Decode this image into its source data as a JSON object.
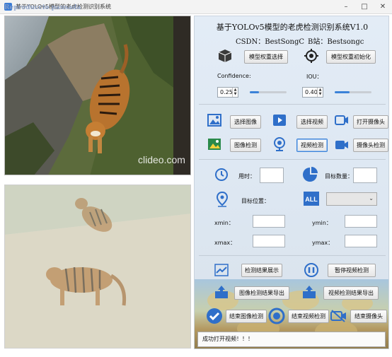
{
  "window": {
    "title": "基于YOLOv5模型的老虎检测识别系统",
    "watermark": "Reproduccio pausada",
    "min_icon": "minimize-icon",
    "max_icon": "maximize-icon",
    "close_icon": "close-icon"
  },
  "images": {
    "top_watermark": "clideo.com"
  },
  "header": {
    "title": "基于YOLOv5模型的老虎检测识别系统V1.0",
    "csdn": "CSDN：BestSongC",
    "bilibili": "B站：Bestsongc"
  },
  "model": {
    "select_label": "模型权重选择",
    "init_label": "模型权重初始化"
  },
  "params": {
    "confidence_label": "Confidence:",
    "confidence_value": "0.25",
    "confidence_level": 0.25,
    "iou_label": "IOU：",
    "iou_value": "0.40",
    "iou_level": 0.4
  },
  "actions": {
    "select_image": "选择图像",
    "select_video": "选择视频",
    "open_camera": "打开摄像头",
    "image_detect": "图像检测",
    "video_detect": "视频检测",
    "camera_detect": "摄像头检测"
  },
  "results": {
    "time_label": "用时：",
    "time_value": "",
    "count_label": "目标数量：",
    "count_value": "",
    "position_label": "目标位置：",
    "position_selected": "",
    "xmin_label": "xmin：",
    "ymin_label": "ymin：",
    "xmax_label": "xmax：",
    "ymax_label": "ymax："
  },
  "controls": {
    "show_results": "检测结果展示",
    "pause_video": "暂停视频检测",
    "export_image": "图像检测结果导出",
    "export_video": "视频检测结果导出",
    "end_image": "结束图像检测",
    "end_video": "结束视频检测",
    "end_camera": "结束摄像头"
  },
  "status": {
    "message": "成功打开视频！！！"
  },
  "colors": {
    "accent": "#3b82d8",
    "icon_blue": "#2f6fc9"
  }
}
